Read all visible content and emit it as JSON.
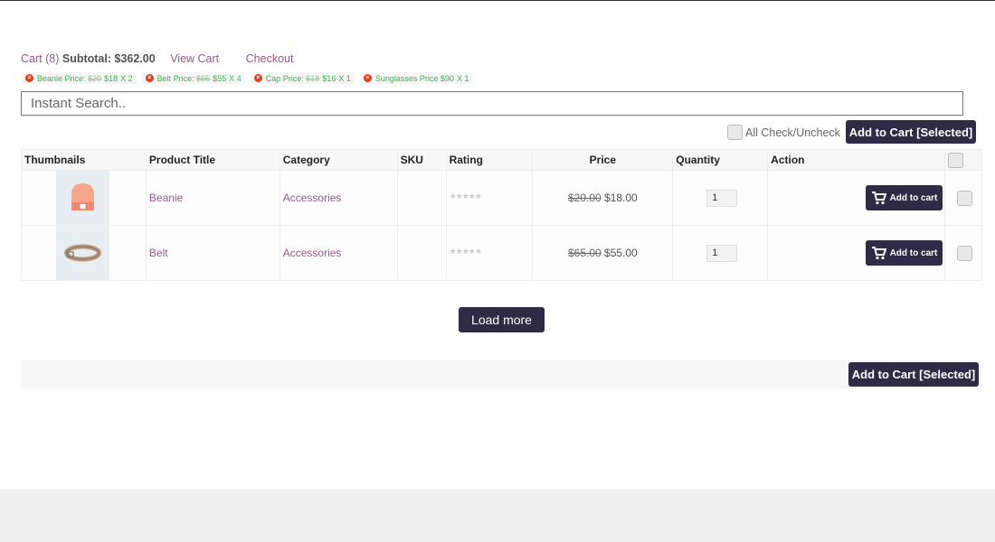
{
  "cart": {
    "count_label": "Cart (8)",
    "subtotal_label": "Subtotal:",
    "subtotal_value": "$362.00",
    "view_cart": "View Cart",
    "checkout": "Checkout",
    "items": [
      {
        "name": "Beanie Price:",
        "old": "$20",
        "price": "$18",
        "qty": "X 2"
      },
      {
        "name": "Belt Price:",
        "old": "$65",
        "price": "$55",
        "qty": "X 4"
      },
      {
        "name": "Cap Price:",
        "old": "$18",
        "price": "$16",
        "qty": "X 1"
      },
      {
        "name": "Sunglasses Price",
        "old": "",
        "price": "$90",
        "qty": "X 1"
      }
    ]
  },
  "search": {
    "placeholder": "Instant Search.."
  },
  "toolbar": {
    "check_all_label": "All Check/Uncheck",
    "add_selected_label": "Add to Cart [Selected]"
  },
  "table": {
    "headers": {
      "thumbnails": "Thumbnails",
      "title": "Product Title",
      "category": "Category",
      "sku": "SKU",
      "rating": "Rating",
      "price": "Price",
      "quantity": "Quantity",
      "action": "Action"
    },
    "rows": [
      {
        "title": "Beanie",
        "category": "Accessories",
        "sku": "",
        "rating": "★★★★★",
        "old_price": "$20.00",
        "price": "$18.00",
        "quantity": "1",
        "action_label": "Add to cart",
        "thumb_icon": "beanie-image"
      },
      {
        "title": "Belt",
        "category": "Accessories",
        "sku": "",
        "rating": "★★★★★",
        "old_price": "$65.00",
        "price": "$55.00",
        "quantity": "1",
        "action_label": "Add to cart",
        "thumb_icon": "belt-image"
      }
    ]
  },
  "load_more_label": "Load more",
  "footer_add_selected_label": "Add to Cart [Selected]",
  "colors": {
    "brand_dark": "#2f2a45",
    "link": "#96588a",
    "cart_item_green": "#39b54a",
    "remove_red": "#e2401c"
  }
}
